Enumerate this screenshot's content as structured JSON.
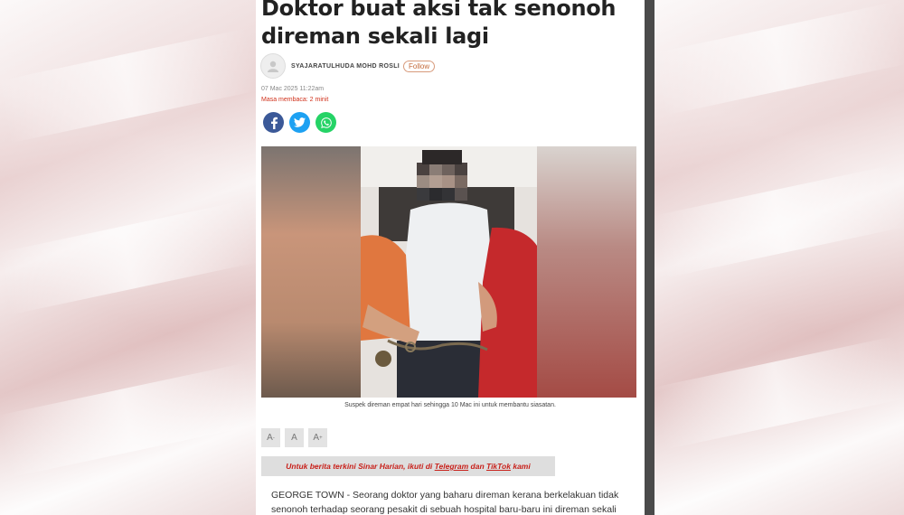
{
  "article": {
    "headline_line1": "Doktor buat aksi tak senonoh",
    "headline_line2": "direman sekali lagi",
    "author": "SYAJARATULHUDA MOHD ROSLI",
    "follow_label": "Follow",
    "date": "07 Mac 2025 11:22am",
    "read_time": "Masa membaca: 2 minit",
    "photo_caption": "Suspek direman empat hari sehingga 10 Mac ini untuk membantu siasatan.",
    "body_line1": "GEORGE TOWN - Seorang doktor yang baharu direman kerana berkelakuan tidak",
    "body_line2": "senonoh terhadap seorang pesakit di sebuah hospital baru-baru ini direman sekali"
  },
  "share": {
    "facebook_icon": "facebook-icon",
    "twitter_icon": "twitter-icon",
    "whatsapp_icon": "whatsapp-icon",
    "colors": {
      "facebook": "#3b5998",
      "twitter": "#1da1f2",
      "whatsapp": "#25d366"
    }
  },
  "font_controls": {
    "decrease_label": "A",
    "decrease_sub": "-",
    "normal_label": "A",
    "increase_label": "A",
    "increase_sub": "+"
  },
  "promo": {
    "prefix": "Untuk berita terkini Sinar Harian, ikuti di ",
    "telegram": "Telegram",
    "middle": " dan ",
    "tiktok": "TikTok",
    "suffix": " kami",
    "color": "#c8201a"
  }
}
